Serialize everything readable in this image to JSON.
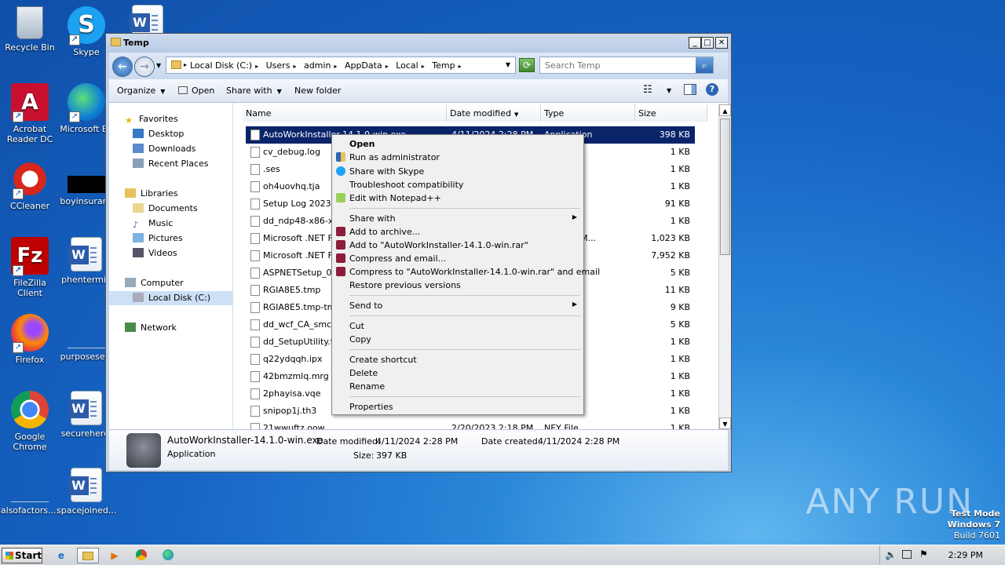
{
  "desktop": {
    "icons": [
      {
        "label": "Recycle Bin"
      },
      {
        "label": "Skype"
      },
      {
        "label": "Acrobat Reader DC"
      },
      {
        "label": "Microsoft Ed"
      },
      {
        "label": "CCleaner"
      },
      {
        "label": "boyinsuranc"
      },
      {
        "label": "FileZilla Client"
      },
      {
        "label": "phentermin"
      },
      {
        "label": "Firefox"
      },
      {
        "label": "purposesele"
      },
      {
        "label": "Google Chrome"
      },
      {
        "label": "securehere."
      },
      {
        "label": "alsofactors...."
      },
      {
        "label": "spacejoined..."
      }
    ]
  },
  "window": {
    "title": "Temp",
    "address": [
      "Local Disk (C:)",
      "Users",
      "admin",
      "AppData",
      "Local",
      "Temp"
    ],
    "search_placeholder": "Search Temp",
    "toolbar": {
      "organize": "Organize",
      "open": "Open",
      "share_with": "Share with",
      "new_folder": "New folder"
    }
  },
  "nav": {
    "favorites": "Favorites",
    "desktop": "Desktop",
    "downloads": "Downloads",
    "recent": "Recent Places",
    "libraries": "Libraries",
    "documents": "Documents",
    "music": "Music",
    "pictures": "Pictures",
    "videos": "Videos",
    "computer": "Computer",
    "local_disk": "Local Disk (C:)",
    "network": "Network"
  },
  "columns": {
    "name": "Name",
    "date": "Date modified",
    "type": "Type",
    "size": "Size"
  },
  "files": [
    {
      "name": "AutoWorkInstaller-14.1.0-win.exe",
      "date": "4/11/2024 2:28 PM",
      "type": "Application",
      "size": "398 KB"
    },
    {
      "name": "cv_debug.log",
      "date": "",
      "type": "ment",
      "size": "1 KB"
    },
    {
      "name": ".ses",
      "date": "",
      "type": "",
      "size": "1 KB"
    },
    {
      "name": "oh4uovhq.tja",
      "date": "",
      "type": "",
      "size": "1 KB"
    },
    {
      "name": "Setup Log 2023-07",
      "date": "",
      "type": "ment",
      "size": "91 KB"
    },
    {
      "name": "dd_ndp48-x86-x64",
      "date": "",
      "type": "ment",
      "size": "1 KB"
    },
    {
      "name": "Microsoft .NET Fra",
      "date": "",
      "type": "Edge HTM...",
      "size": "1,023 KB"
    },
    {
      "name": "Microsoft .NET Fra",
      "date": "",
      "type": "ment",
      "size": "7,952 KB"
    },
    {
      "name": "ASPNETSetup_000",
      "date": "",
      "type": "ment",
      "size": "5 KB"
    },
    {
      "name": "RGIA8E5.tmp",
      "date": "",
      "type": "",
      "size": "11 KB"
    },
    {
      "name": "RGIA8E5.tmp-tmp",
      "date": "",
      "type": "File",
      "size": "9 KB"
    },
    {
      "name": "dd_wcf_CA_smci_",
      "date": "",
      "type": "ment",
      "size": "5 KB"
    },
    {
      "name": "dd_SetupUtility.tx",
      "date": "",
      "type": "ment",
      "size": "1 KB"
    },
    {
      "name": "q22ydqqh.ipx",
      "date": "",
      "type": "",
      "size": "1 KB"
    },
    {
      "name": "42bmzmlq.mrg",
      "date": "",
      "type": "",
      "size": "1 KB"
    },
    {
      "name": "2phayisa.vqe",
      "date": "",
      "type": "",
      "size": "1 KB"
    },
    {
      "name": "snipop1j.th3",
      "date": "",
      "type": "",
      "size": "1 KB"
    },
    {
      "name": "21wwuftz.oow",
      "date": "2/20/2023 2:18 PM",
      "type": "NEY File",
      "size": "1 KB"
    }
  ],
  "details": {
    "name": "AutoWorkInstaller-14.1.0-win.exe",
    "type": "Application",
    "modified_label": "Date modified:",
    "modified": "4/11/2024 2:28 PM",
    "created_label": "Date created:",
    "created": "4/11/2024 2:28 PM",
    "size_label": "Size:",
    "size": "397 KB"
  },
  "context_menu": {
    "open": "Open",
    "run_admin": "Run as administrator",
    "share_skype": "Share with Skype",
    "troubleshoot": "Troubleshoot compatibility",
    "notepadpp": "Edit with Notepad++",
    "share_with": "Share with",
    "add_archive": "Add to archive...",
    "add_rar": "Add to \"AutoWorkInstaller-14.1.0-win.rar\"",
    "compress_email": "Compress and email...",
    "compress_rar_email": "Compress to \"AutoWorkInstaller-14.1.0-win.rar\" and email",
    "restore": "Restore previous versions",
    "send_to": "Send to",
    "cut": "Cut",
    "copy": "Copy",
    "create_shortcut": "Create shortcut",
    "delete": "Delete",
    "rename": "Rename",
    "properties": "Properties"
  },
  "taskbar": {
    "start": "Start",
    "clock": "2:29 PM"
  },
  "watermark": "ANY RUN",
  "os": {
    "line1": "Test Mode",
    "line2": "Windows 7",
    "line3": "Build 7601"
  },
  "colors": {
    "selection": "#0a246a",
    "desktop": "#1664c4"
  }
}
